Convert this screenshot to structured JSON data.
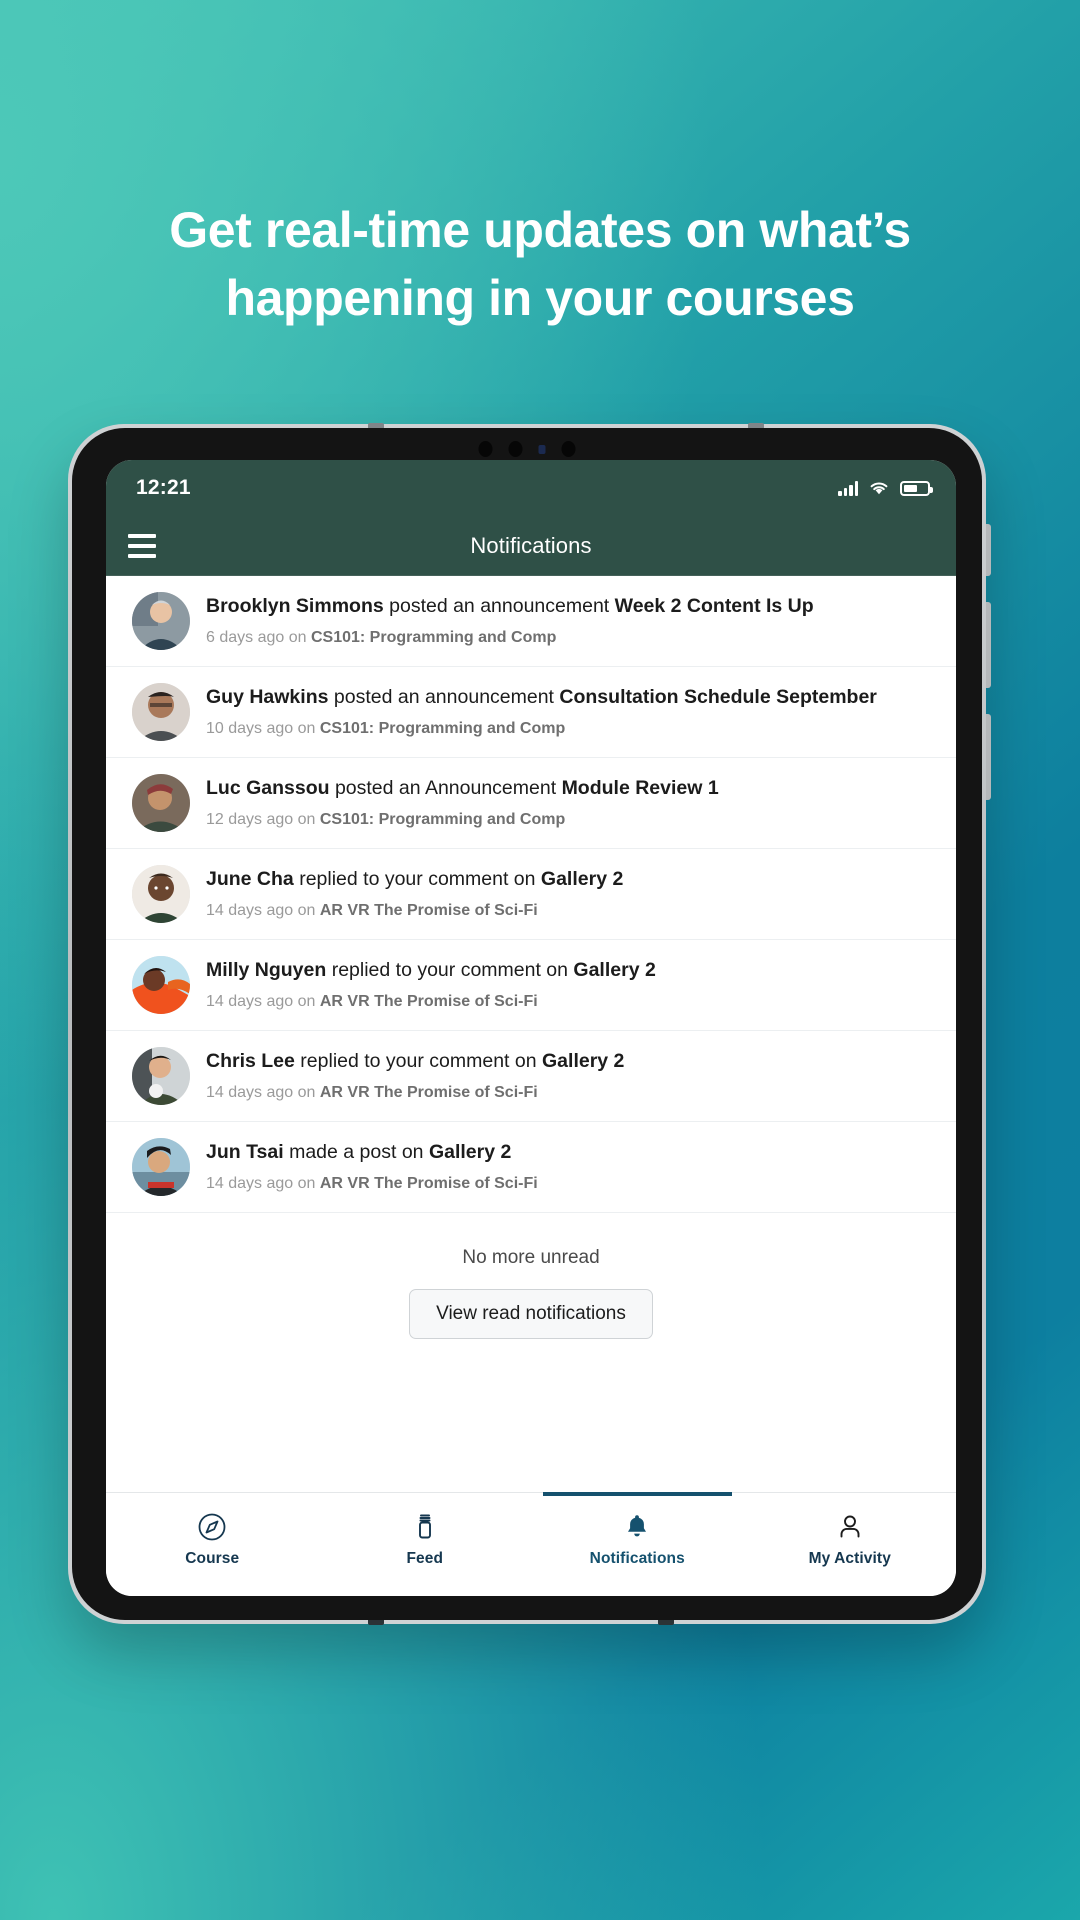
{
  "promo": {
    "headline_line1": "Get real-time updates on what’s",
    "headline_line2": "happening in your courses",
    "background_start": "#46c3b6",
    "background_end": "#0d7f9e"
  },
  "status_bar": {
    "time": "12:21",
    "signal_icon": "signal-bars-icon",
    "wifi_icon": "wifi-icon",
    "battery_icon": "battery-icon",
    "battery_level": "58%"
  },
  "app_bar": {
    "menu_icon": "hamburger-menu-icon",
    "title": "Notifications",
    "background": "#2f5047"
  },
  "notifications": [
    {
      "actor": "Brooklyn Simmons",
      "action": "posted an announcement",
      "target": "Week 2 Content Is Up",
      "time": "6 days ago on ",
      "course": "CS101: Programming and Comp",
      "avatar": "avatar-brooklyn-simmons"
    },
    {
      "actor": "Guy Hawkins",
      "action": "posted an announcement",
      "target": "Consultation Schedule September",
      "time": "10 days ago on ",
      "course": "CS101: Programming and Comp",
      "avatar": "avatar-guy-hawkins"
    },
    {
      "actor": "Luc Ganssou",
      "action": "posted an Announcement",
      "target": "Module Review 1",
      "time": "12 days ago on ",
      "course": "CS101: Programming and Comp",
      "avatar": "avatar-luc-ganssou"
    },
    {
      "actor": "June Cha",
      "action": "replied to your comment on",
      "target": "Gallery 2",
      "time": "14 days ago on ",
      "course": "AR VR The Promise of Sci-Fi",
      "avatar": "avatar-june-cha"
    },
    {
      "actor": "Milly Nguyen",
      "action": "replied to your comment on",
      "target": "Gallery 2",
      "time": "14 days ago on ",
      "course": "AR VR The Promise of Sci-Fi",
      "avatar": "avatar-milly-nguyen"
    },
    {
      "actor": "Chris Lee",
      "action": "replied to your comment on",
      "target": "Gallery 2",
      "time": "14 days ago on ",
      "course": "AR VR The Promise of Sci-Fi",
      "avatar": "avatar-chris-lee"
    },
    {
      "actor": "Jun Tsai",
      "action": "made a post on",
      "target": "Gallery 2",
      "time": "14 days ago on ",
      "course": "AR VR The Promise of Sci-Fi",
      "avatar": "avatar-jun-tsai"
    }
  ],
  "list_footer": {
    "empty_text": "No more unread",
    "button_label": "View read notifications"
  },
  "tab_bar": {
    "accent_color": "#15516e",
    "items": [
      {
        "label": "Course",
        "icon": "compass-icon",
        "active": false
      },
      {
        "label": "Feed",
        "icon": "jar-icon",
        "active": false
      },
      {
        "label": "Notifications",
        "icon": "bell-icon",
        "active": true
      },
      {
        "label": "My Activity",
        "icon": "person-icon",
        "active": false
      }
    ]
  }
}
